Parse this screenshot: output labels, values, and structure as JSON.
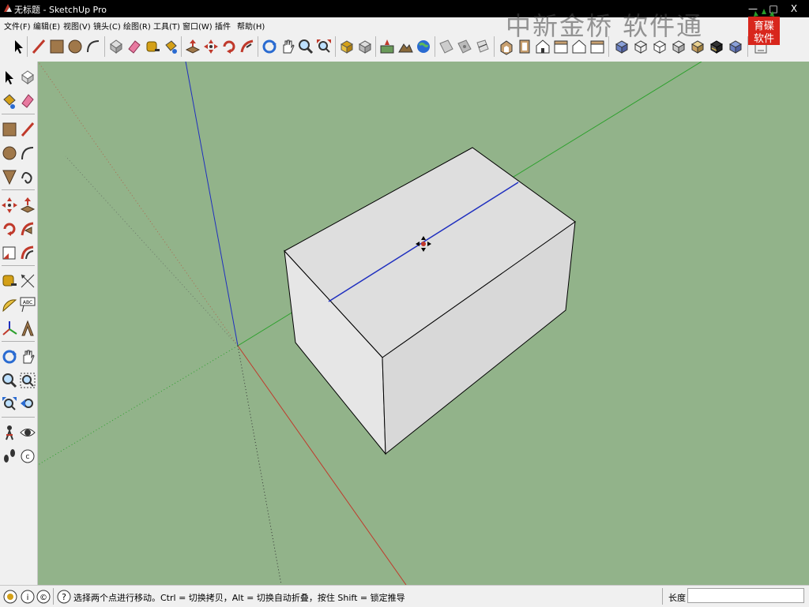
{
  "window": {
    "title": "无标题 - SketchUp Pro",
    "minimize_glyph": "—",
    "maximize_glyph": "□",
    "close_glyph": "X"
  },
  "menu": {
    "items": [
      "文件(F)",
      "编辑(E)",
      "视图(V)",
      "镜头(C)",
      "绘图(R)",
      "工具(T)",
      "窗口(W)",
      "插件",
      "帮助(H)"
    ]
  },
  "watermark": {
    "text": "中新金桥 软件通"
  },
  "logo": {
    "text_line1": "育碟",
    "text_line2": "软件"
  },
  "toolbar": {
    "icons": [
      "select-icon",
      "line-icon",
      "rectangle-icon",
      "circle-icon",
      "arc-icon",
      "make-component-icon",
      "eraser-icon",
      "tape-measure-icon",
      "paint-bucket-icon",
      "push-pull-icon",
      "move-icon",
      "rotate-icon",
      "follow-me-icon",
      "orbit-icon",
      "pan-icon",
      "zoom-icon",
      "zoom-extents-icon",
      "get-models-icon",
      "share-model-icon",
      "add-location-icon",
      "toggle-terrain-icon",
      "preview-google-earth-icon",
      "section-plane-icon",
      "display-section-icon",
      "display-section-cuts-icon",
      "iso-view-icon",
      "top-view-icon",
      "front-view-icon",
      "right-view-icon",
      "back-view-icon",
      "left-view-icon",
      "xray-icon",
      "wireframe-icon",
      "hidden-line-icon",
      "shaded-icon",
      "shaded-textures-icon",
      "monochrome-icon",
      "sandbox-icon"
    ]
  },
  "lefttoolbar": {
    "icons": [
      "select-icon",
      "make-component-icon",
      "paint-bucket-icon",
      "eraser-icon",
      "rectangle-icon",
      "line-icon",
      "circle-icon",
      "arc-icon",
      "polygon-icon",
      "freehand-icon",
      "move-icon",
      "push-pull-icon",
      "rotate-icon",
      "follow-me-icon",
      "scale-icon",
      "offset-icon",
      "tape-measure-icon",
      "dimension-icon",
      "protractor-icon",
      "text-icon",
      "axes-icon",
      "3d-text-icon",
      "orbit-icon",
      "pan-icon",
      "zoom-icon",
      "zoom-window-icon",
      "zoom-extents-icon",
      "previous-view-icon",
      "position-camera-icon",
      "look-around-icon",
      "walk-icon",
      "section-plane-icon"
    ]
  },
  "status": {
    "message": "选择两个点进行移动。Ctrl = 切换拷贝，Alt = 切换自动折叠，按住 Shift = 锁定推导",
    "measurement_label": "长度",
    "measurement_value": "",
    "icons": [
      "geo-location-icon",
      "credits-icon",
      "user-icon",
      "help-icon"
    ]
  },
  "colors": {
    "viewport_bg": "#92b38a",
    "red_axis": "#c0392b",
    "green_axis": "#2ca02c",
    "blue_axis": "#1f2fbf",
    "box_face": "#dcdcdc"
  }
}
